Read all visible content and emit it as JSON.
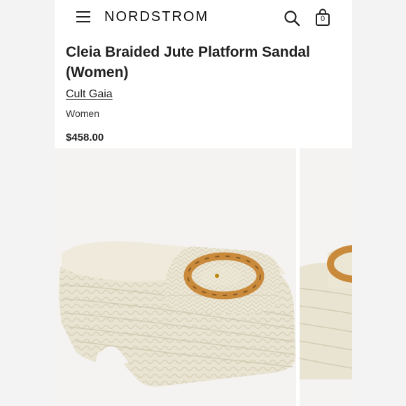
{
  "header": {
    "logo": "NORDSTROM",
    "bag_count": "0",
    "icons": [
      "menu-icon",
      "search-icon",
      "shopping-bag-icon"
    ]
  },
  "product": {
    "title": "Cleia Braided Jute Platform Sandal (Women)",
    "brand": "Cult Gaia",
    "audience": "Women",
    "price": "$458.00"
  },
  "gallery": {
    "images": [
      "sandal-side-view",
      "sandal-partial-view"
    ]
  },
  "colors": {
    "page_background": "#f2f2f2",
    "panel_background": "#ffffff",
    "text_primary": "#222222",
    "jute": "#e8e2cf",
    "tortoiseshell": "#c98a3c"
  }
}
